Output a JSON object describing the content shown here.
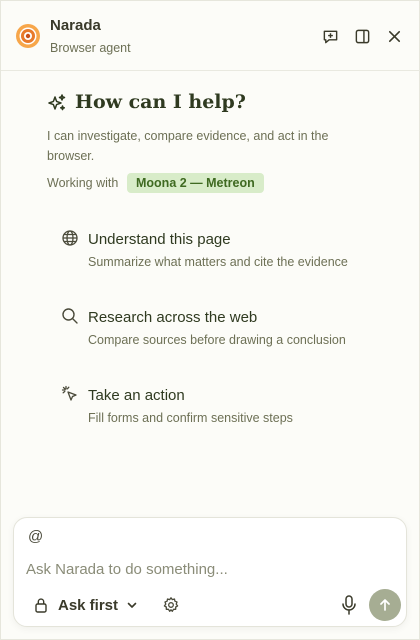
{
  "header": {
    "app_name": "Narada",
    "subtitle": "Browser agent",
    "icons": [
      "new-chat-icon",
      "sidebar-panel-icon",
      "close-icon"
    ]
  },
  "hero": {
    "title": "How can I help?",
    "description": "I can investigate, compare evidence, and act in the browser.",
    "working_with_label": "Working with",
    "context_chip": "Moona 2 — Metreon"
  },
  "suggestions": [
    {
      "icon": "globe-icon",
      "title": "Understand this page",
      "description": "Summarize what matters and cite the evidence"
    },
    {
      "icon": "search-icon",
      "title": "Research across the web",
      "description": "Compare sources before drawing a conclusion"
    },
    {
      "icon": "cursor-click-icon",
      "title": "Take an action",
      "description": "Fill forms and confirm sensitive steps"
    }
  ],
  "composer": {
    "mention_symbol": "@",
    "placeholder": "Ask Narada to do something...",
    "value": "",
    "mode_label": "Ask first"
  },
  "colors": {
    "accent_orange": "#e87a2b",
    "chip_bg": "#d8ecc9",
    "chip_text": "#3f6a21",
    "send_button": "#a6ad93"
  }
}
